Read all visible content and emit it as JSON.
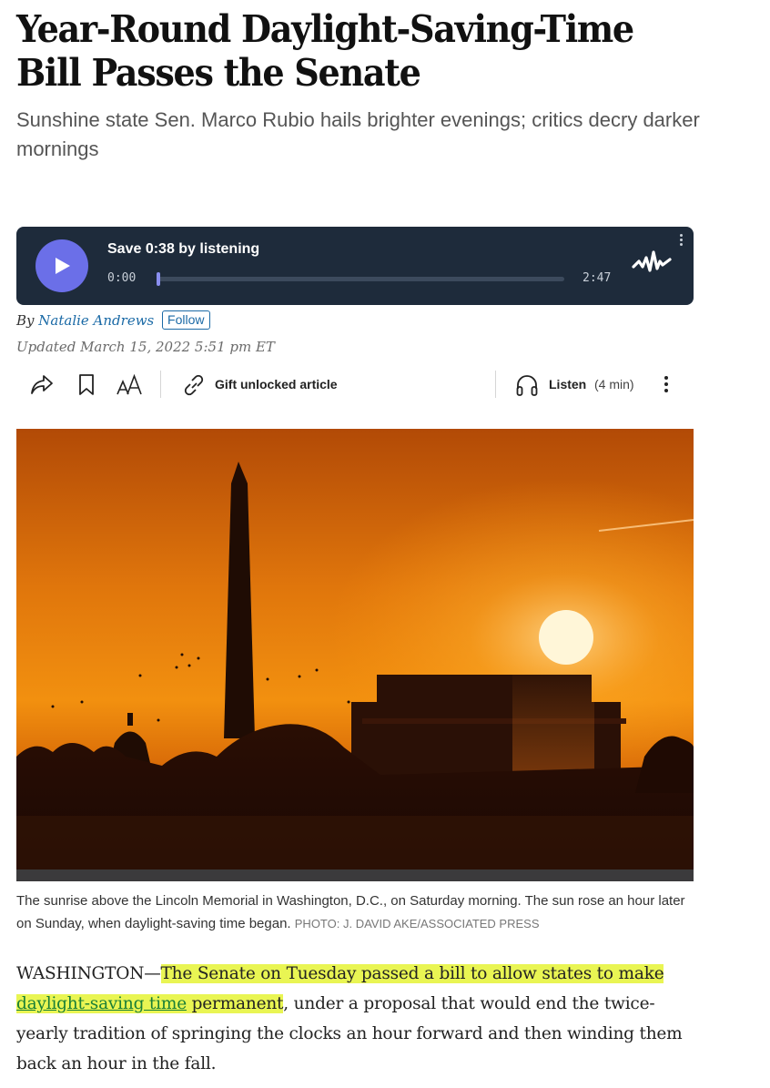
{
  "article": {
    "headline": "Year-Round Daylight-Saving-Time Bill Passes the Senate",
    "dek": "Sunshine state Sen. Marco Rubio hails brighter evenings; critics decry darker mornings"
  },
  "audio_player": {
    "title": "Save 0:38 by listening",
    "time_start": "0:00",
    "time_end": "2:47",
    "progress": 0.0,
    "background": "#1e2b3b",
    "accent": "#6b6fe8",
    "play_icon": "play-icon",
    "logo_icon": "audio-waveform-logo-icon"
  },
  "byline": {
    "prefix": "By",
    "author": "Natalie Andrews",
    "follow_label": "Follow",
    "updated": "Updated March 15, 2022 5:51 pm ET"
  },
  "toolbar": {
    "share_icon": "share-icon",
    "bookmark_icon": "bookmark-icon",
    "text_size_icon": "text-size-icon",
    "gift_icon": "link-icon",
    "gift_label": "Gift unlocked article",
    "listen_icon": "headphones-icon",
    "listen_label": "Listen",
    "listen_duration": "(4 min)",
    "more_icon": "more-vertical-icon"
  },
  "photo": {
    "caption": "The sunrise above the Lincoln Memorial in Washington, D.C., on Saturday morning. The sun rose an hour later on Sunday, when daylight-saving time began.",
    "credit": "PHOTO: J. DAVID AKE/ASSOCIATED PRESS"
  },
  "body": {
    "dateline": "WASHINGTON—",
    "highlight_start": "The Senate on Tuesday passed a bill to allow states to make ",
    "link_text": "daylight-saving time",
    "highlight_end": " permanent",
    "rest": ", under a proposal that would end the twice-yearly tradition of springing the clocks an hour forward and then winding them back an hour in the fall.",
    "highlight_color": "#e9f553",
    "link_color": "#1a7f37"
  }
}
